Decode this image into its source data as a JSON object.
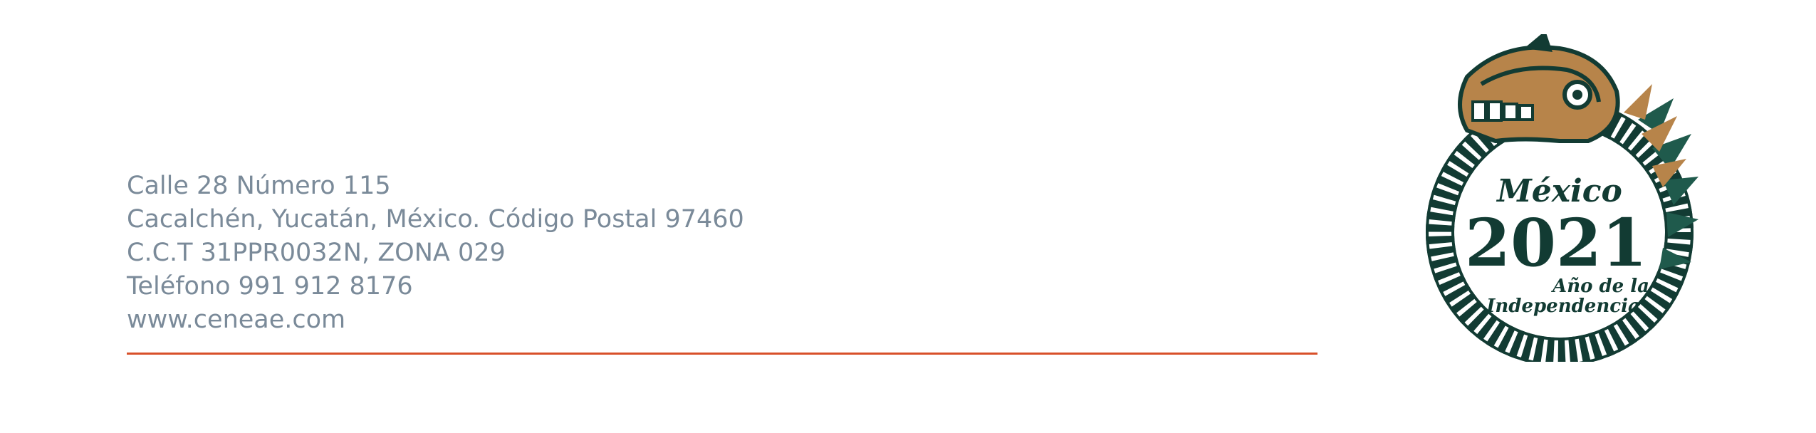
{
  "address": {
    "street": "Calle 28 Número 115",
    "city": "Cacalchén, Yucatán, México. Código Postal 97460",
    "cct": "C.C.T 31PPR0032N, ZONA 029",
    "phone": "Teléfono 991 912 8176",
    "website": "www.ceneae.com"
  },
  "seal": {
    "country": "México",
    "year": "2021",
    "motto_line1": "Año de la",
    "motto_line2": "Independencia"
  },
  "colors": {
    "text": "#7a8a99",
    "rule": "#d8502a",
    "seal_green": "#123b33",
    "seal_gold": "#b7844a"
  }
}
